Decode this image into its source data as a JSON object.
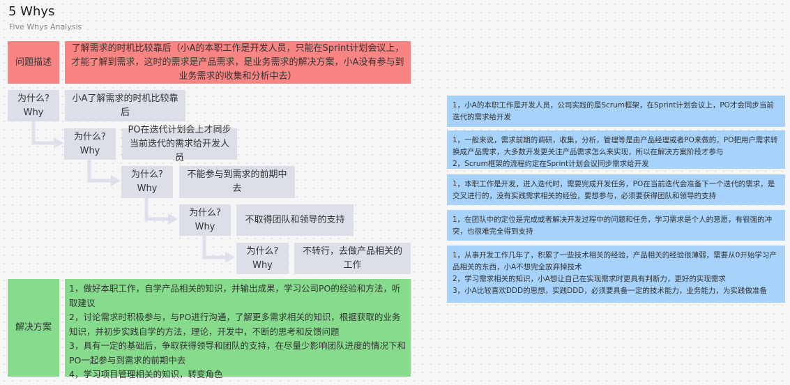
{
  "header": {
    "title": "5 Whys",
    "subtitle": "Five Whys Analysis"
  },
  "problem": {
    "label": "问题描述",
    "text": "了解需求的时机比较靠后（小A的本职工作是开发人员，只能在Sprint计划会议上，才能了解到需求，这时的需求是产品需求，是业务需求的解决方案，小A没有参与到业务需求的收集和分析中去）"
  },
  "whys": [
    {
      "label_cn": "为什么?",
      "label_en": "Why",
      "answer": "小A了解需求的时机比较靠后"
    },
    {
      "label_cn": "为什么?",
      "label_en": "Why",
      "answer": "PO在迭代计划会上才同步当前迭代的需求给开发人员"
    },
    {
      "label_cn": "为什么?",
      "label_en": "Why",
      "answer": "不能参与到需求的前期中去"
    },
    {
      "label_cn": "为什么?",
      "label_en": "Why",
      "answer": "不取得团队和领导的支持"
    },
    {
      "label_cn": "为什么?",
      "label_en": "Why",
      "answer": "不转行，去做产品相关的工作"
    }
  ],
  "solution": {
    "label": "解决方案",
    "items": [
      "1，做好本职工作，自学产品相关的知识，并输出成果，学习公司PO的经验和方法，听取建议",
      "2，讨论需求时积极参与，与PO进行沟通，了解更多需求相关的知识，根据获取的业务知识，并初步实践自学的方法，理论，开发中，不断的思考和反馈问题",
      "3，具有一定的基础后，争取获得领导和团队的支持，在尽量少影响团队进度的情况下和PO一起参与到需求的前期中去",
      "4，学习项目管理相关的知识，转变角色"
    ]
  },
  "notes": [
    {
      "lines": [
        "1，小A的本职工作是开发人员，公司实践的是Scrum框架，在Sprint计划会议上，PO才会同步当前迭代的需求给开发"
      ]
    },
    {
      "lines": [
        "1，一般来说，需求前期的调研，收集，分析，管理等是由产品经理或者PO来做的，PO把用户需求转换成产品需求，大多数开发更关注产品需求怎么来实现，所以在解决方案阶段才参与",
        "2，Scrum框架的流程约定在Sprint计划会议同步需求给开发"
      ]
    },
    {
      "lines": [
        "1，本职工作是开发，进入迭代时，需要完成开发任务，PO在当前迭代会准备下一个迭代的需求，是交叉进行的，没有实践需求相关的经验，要想参与，必须要获得团队和领导的支持"
      ]
    },
    {
      "lines": [
        "1，在团队中的定位是完成或者解决开发过程中的问题和任务，学习需求是个人的意愿，有很强的冲突，也很难完全得到支持"
      ]
    },
    {
      "lines": [
        "1，从事开发工作几年了，积累了一些技术相关的经验，产品相关的经验很薄弱，需要从0开始学习产品相关的东西，小A不想完全放弃掉技术",
        "2，学习需求相关的知识，小A想让自己在实现需求时更具有判断力，更好的实现需求",
        "3，小A比较喜欢DDD的思想，实践DDD，必须要具备一定的技术能力，业务能力，为实践做准备"
      ]
    }
  ]
}
